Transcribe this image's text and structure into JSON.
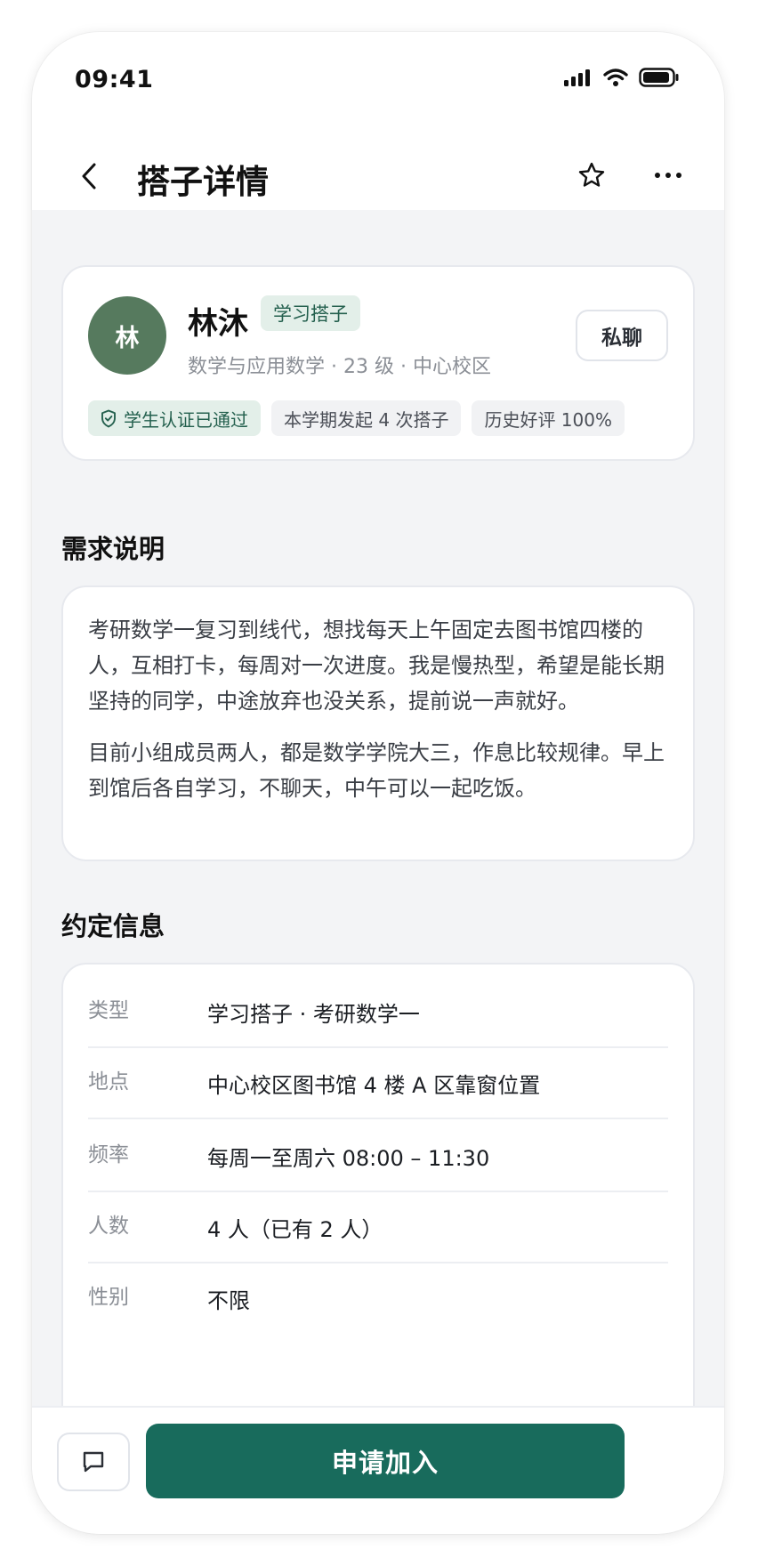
{
  "status_bar": {
    "time": "09:41"
  },
  "nav": {
    "title": "搭子详情",
    "icons": [
      "chevron-left-icon",
      "star-icon",
      "more-icon"
    ]
  },
  "profile": {
    "avatar_text": "林",
    "name": "林沐",
    "tag": "学习搭子",
    "meta": "数学与应用数学 · 23 级 · 中心校区",
    "chat_label": "私聊",
    "badges": [
      "学生认证已通过",
      "本学期发起 4 次搭子",
      "历史好评 100%"
    ]
  },
  "description": {
    "title": "需求说明",
    "paragraphs": [
      "考研数学一复习到线代，想找每天上午固定去图书馆四楼的人，互相打卡，每周对一次进度。我是慢热型，希望是能长期坚持的同学，中途放弃也没关系，提前说一声就好。",
      "目前小组成员两人，都是数学学院大三，作息比较规律。早上到馆后各自学习，不聊天，中午可以一起吃饭。"
    ]
  },
  "info": {
    "title": "约定信息",
    "rows": [
      {
        "label": "类型",
        "value": "学习搭子 · 考研数学一"
      },
      {
        "label": "地点",
        "value": "中心校区图书馆 4 楼 A 区靠窗位置"
      },
      {
        "label": "频率",
        "value": "每周一至周六 08:00 – 11:30"
      },
      {
        "label": "人数",
        "value": "4 人（已有 2 人）"
      },
      {
        "label": "性别",
        "value": "不限"
      }
    ]
  },
  "actions": {
    "join_label": "申请加入"
  },
  "colors": {
    "primary": "#186b5c",
    "tag_bg": "#e3efe9",
    "tag_text": "#24604e",
    "avatar_bg": "#567a5e",
    "page_bg": "#f3f4f6"
  }
}
